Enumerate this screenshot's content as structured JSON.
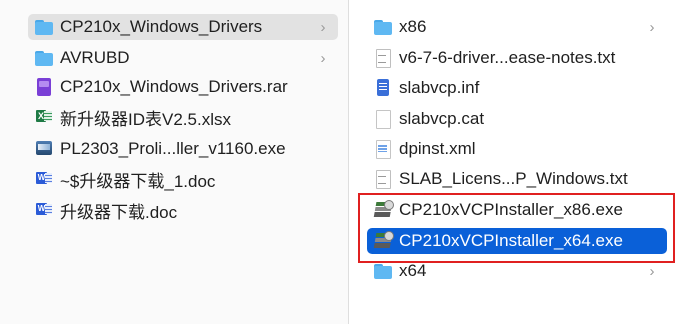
{
  "left_column": {
    "items": [
      {
        "label": "CP210x_Windows_Drivers",
        "icon": "folder-icon",
        "has_chevron": true
      },
      {
        "label": "AVRUBD",
        "icon": "folder-icon",
        "has_chevron": true
      },
      {
        "label": "CP210x_Windows_Drivers.rar",
        "icon": "rar-archive-icon",
        "has_chevron": false
      },
      {
        "label": "新升级器ID表V2.5.xlsx",
        "icon": "excel-icon",
        "has_chevron": false
      },
      {
        "label": "PL2303_Proli...ller_v1160.exe",
        "icon": "exe-icon",
        "has_chevron": false
      },
      {
        "label": "~$升级器下载_1.doc",
        "icon": "word-icon",
        "has_chevron": false
      },
      {
        "label": "升级器下载.doc",
        "icon": "word-icon",
        "has_chevron": false
      }
    ]
  },
  "right_column": {
    "items": [
      {
        "label": "x86",
        "icon": "folder-icon",
        "has_chevron": true
      },
      {
        "label": "v6-7-6-driver...ease-notes.txt",
        "icon": "txt-icon",
        "has_chevron": false
      },
      {
        "label": "slabvcp.inf",
        "icon": "inf-icon",
        "has_chevron": false
      },
      {
        "label": "slabvcp.cat",
        "icon": "file-icon",
        "has_chevron": false
      },
      {
        "label": "dpinst.xml",
        "icon": "xml-icon",
        "has_chevron": false
      },
      {
        "label": "SLAB_Licens...P_Windows.txt",
        "icon": "txt-icon",
        "has_chevron": false
      },
      {
        "label": "CP210xVCPInstaller_x86.exe",
        "icon": "installer-icon",
        "has_chevron": false
      },
      {
        "label": "CP210xVCPInstaller_x64.exe",
        "icon": "installer-icon",
        "has_chevron": false
      },
      {
        "label": "x64",
        "icon": "folder-icon",
        "has_chevron": true
      }
    ]
  },
  "chevron": "›",
  "colors": {
    "selection_blue": "#0a60d8",
    "selection_gray": "#e2e2e2",
    "highlight_red": "#e02020",
    "folder_blue": "#5fb8f2"
  }
}
